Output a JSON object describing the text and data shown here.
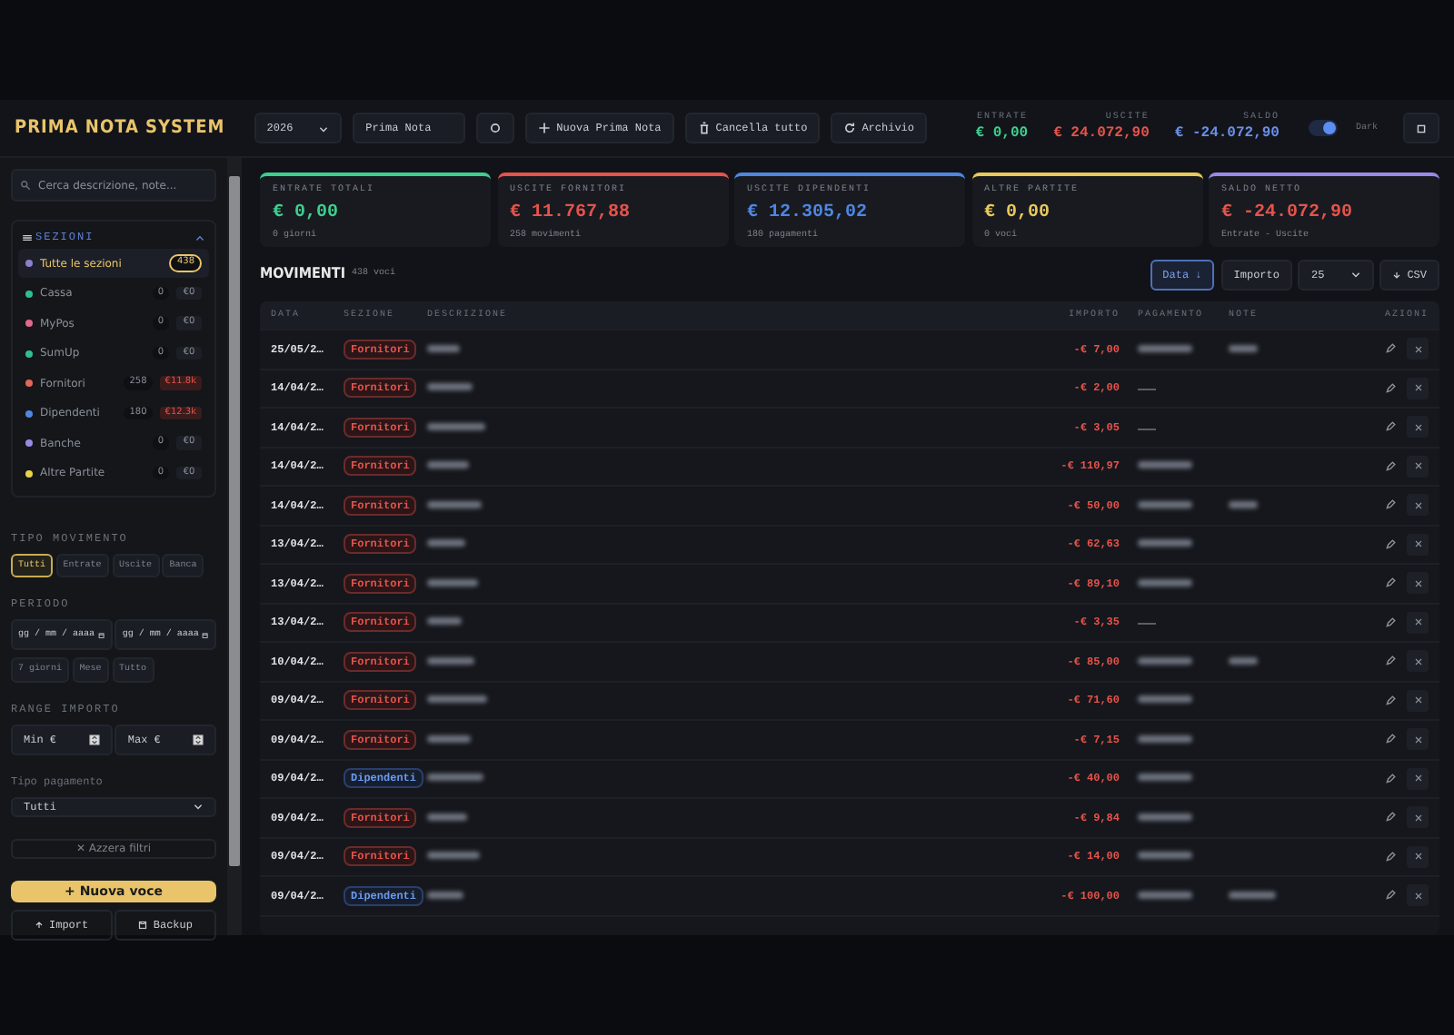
{
  "topbar": {
    "title": "PRIMA NOTA SYSTEM",
    "year": "2026",
    "book": "Prima Nota",
    "actions": [
      {
        "kind": "add",
        "label": "Nuova Prima Nota"
      },
      {
        "kind": "trash",
        "label": "Cancella tutto"
      },
      {
        "kind": "archive",
        "label": "Archivio"
      }
    ],
    "totals": [
      {
        "label": "ENTRATE",
        "value": "€ 0,00",
        "color": "#3ecf8e"
      },
      {
        "label": "USCITE",
        "value": "€ 24.072,90",
        "color": "#e5534b"
      },
      {
        "label": "SALDO",
        "value": "€ -24.072,90",
        "color": "#6b8fe8"
      }
    ],
    "theme_toggle": {
      "on": true,
      "label": "Dark"
    }
  },
  "sidebar": {
    "search": {
      "placeholder": "Cerca descrizione, note..."
    },
    "sections_title": "SEZIONI",
    "expanded": true,
    "sections": [
      {
        "name": "Tutte le sezioni",
        "count": "438",
        "selected": true,
        "color": "#8b80c9"
      },
      {
        "name": "Cassa",
        "count": "0",
        "amount": "€0",
        "selected": false,
        "color": "#2fbf8f"
      },
      {
        "name": "MyPos",
        "count": "0",
        "amount": "€0",
        "selected": false,
        "color": "#e2698c"
      },
      {
        "name": "SumUp",
        "count": "0",
        "amount": "€0",
        "selected": false,
        "color": "#2fbf8f"
      },
      {
        "name": "Fornitori",
        "count": "258",
        "amount": "€11.8k",
        "selected": false,
        "color": "#e0675a"
      },
      {
        "name": "Dipendenti",
        "count": "180",
        "amount": "€12.3k",
        "selected": false,
        "color": "#4f86e0"
      },
      {
        "name": "Banche",
        "count": "0",
        "amount": "€0",
        "selected": false,
        "color": "#9a88e8"
      },
      {
        "name": "Altre Partite",
        "count": "0",
        "amount": "€0",
        "selected": false,
        "color": "#e8d24a"
      }
    ],
    "type_title": "TIPO MOVIMENTO",
    "types": [
      {
        "label": "Tutti",
        "selected": true
      },
      {
        "label": "Entrate",
        "selected": false
      },
      {
        "label": "Uscite",
        "selected": false
      },
      {
        "label": "Banca",
        "selected": false
      }
    ],
    "period_title": "PERIODO",
    "date_placeholders": [
      "gg / mm / aaaa",
      "gg / mm / aaaa"
    ],
    "periods": [
      "7 giorni",
      "Mese",
      "Tutto"
    ],
    "range_title": "RANGE IMPORTO",
    "range_placeholders": [
      "Min €",
      "Max €"
    ],
    "payment_title": "Tipo pagamento",
    "payment_value": "Tutti",
    "reset": "✕ Azzera filtri",
    "new_entry": "+ Nuova voce",
    "bottom": [
      {
        "kind": "import",
        "label": "Import"
      },
      {
        "kind": "backup",
        "label": "Backup"
      }
    ]
  },
  "cards": [
    {
      "label": "ENTRATE TOTALI",
      "value": "€ 0,00",
      "sub": "0 giorni",
      "color": "#3ecf8e"
    },
    {
      "label": "USCITE FORNITORI",
      "value": "€ 11.767,88",
      "sub": "258 movimenti",
      "color": "#e5534b"
    },
    {
      "label": "USCITE DIPENDENTI",
      "value": "€ 12.305,02",
      "sub": "180 pagamenti",
      "color": "#4f86e0"
    },
    {
      "label": "ALTRE PARTITE",
      "value": "€ 0,00",
      "sub": "0 voci",
      "color": "#e8c95a"
    },
    {
      "label": "SALDO NETTO",
      "value": "€ -24.072,90",
      "sub": "Entrate - Uscite",
      "color": "#9a88e8"
    }
  ],
  "movements": {
    "title": "MOVIMENTI",
    "count": "438 voci",
    "sorts": [
      {
        "label": "Data ↓",
        "selected": true
      },
      {
        "label": "Importo",
        "selected": false
      }
    ],
    "page_size": "25",
    "export": "CSV",
    "columns": [
      "DATA",
      "SEZIONE",
      "DESCRIZIONE",
      "IMPORTO",
      "PAGAMENTO",
      "NOTE",
      "AZIONI"
    ],
    "rows": [
      {
        "date": "25/05/2…",
        "section": "Fornitori",
        "amount": "-€ 7,00",
        "payment_redacted": true,
        "note": true
      },
      {
        "date": "14/04/2…",
        "section": "Fornitori",
        "amount": "-€ 2,00",
        "payment_redacted": false,
        "note": false
      },
      {
        "date": "14/04/2…",
        "section": "Fornitori",
        "amount": "-€ 3,05",
        "payment_redacted": false,
        "note": false
      },
      {
        "date": "14/04/2…",
        "section": "Fornitori",
        "amount": "-€ 110,97",
        "payment_redacted": true,
        "note": false
      },
      {
        "date": "14/04/2…",
        "section": "Fornitori",
        "amount": "-€ 50,00",
        "payment_redacted": true,
        "note": true
      },
      {
        "date": "13/04/2…",
        "section": "Fornitori",
        "amount": "-€ 62,63",
        "payment_redacted": true,
        "note": false
      },
      {
        "date": "13/04/2…",
        "section": "Fornitori",
        "amount": "-€ 89,10",
        "payment_redacted": true,
        "note": false
      },
      {
        "date": "13/04/2…",
        "section": "Fornitori",
        "amount": "-€ 3,35",
        "payment_redacted": false,
        "note": false
      },
      {
        "date": "10/04/2…",
        "section": "Fornitori",
        "amount": "-€ 85,00",
        "payment_redacted": true,
        "note": true
      },
      {
        "date": "09/04/2…",
        "section": "Fornitori",
        "amount": "-€ 71,60",
        "payment_redacted": true,
        "note": false
      },
      {
        "date": "09/04/2…",
        "section": "Fornitori",
        "amount": "-€ 7,15",
        "payment_redacted": true,
        "note": false
      },
      {
        "date": "09/04/2…",
        "section": "Dipendenti",
        "amount": "-€ 40,00",
        "payment_redacted": true,
        "note": false
      },
      {
        "date": "09/04/2…",
        "section": "Fornitori",
        "amount": "-€ 9,84",
        "payment_redacted": true,
        "note": false
      },
      {
        "date": "09/04/2…",
        "section": "Fornitori",
        "amount": "-€ 14,00",
        "payment_redacted": true,
        "note": false
      },
      {
        "date": "09/04/2…",
        "section": "Dipendenti",
        "amount": "-€ 100,00",
        "payment_redacted": true,
        "note": true
      }
    ]
  }
}
